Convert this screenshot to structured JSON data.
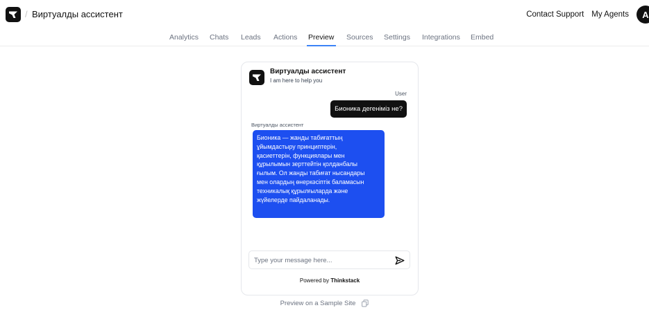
{
  "header": {
    "app_title": "Виртуалды ассистент",
    "contact_support": "Contact Support",
    "my_agents": "My Agents",
    "avatar_letter": "A"
  },
  "tabs": [
    {
      "label": "Analytics",
      "active": false
    },
    {
      "label": "Chats",
      "active": false
    },
    {
      "label": "Leads",
      "active": false
    },
    {
      "label": "Actions",
      "active": false
    },
    {
      "label": "Preview",
      "active": true
    },
    {
      "label": "Sources",
      "active": false
    },
    {
      "label": "Settings",
      "active": false
    },
    {
      "label": "Integrations",
      "active": false
    },
    {
      "label": "Embed",
      "active": false
    }
  ],
  "chat": {
    "title": "Виртуалды ассистент",
    "subtitle": "I am here to help you",
    "user_label": "User",
    "user_message": "Бионика дегеніміз не?",
    "bot_label": "Виртуалды ассистент",
    "bot_message_lines": [
      "Бионика — жанды табиғаттың",
      "ұйымдастыру принциптерін,",
      "қасиеттерін, функциялары мен",
      "құрылымын зерттейтін қолданбалы",
      "ғылым. Ол жанды табиғат нысандары",
      "мен олардың өнеркәсіптік баламасын",
      "техникалық құрылғыларда және",
      "жүйелерде пайдаланады."
    ],
    "input_placeholder": "Type your message here...",
    "powered_by_prefix": "Powered by",
    "powered_by_brand": "Thinkstack"
  },
  "footer": {
    "preview_link": "Preview on a Sample Site"
  },
  "colors": {
    "bot_bubble": "#1d4ff0",
    "user_bubble": "#111111",
    "active_tab_underline": "#3b82f6"
  }
}
